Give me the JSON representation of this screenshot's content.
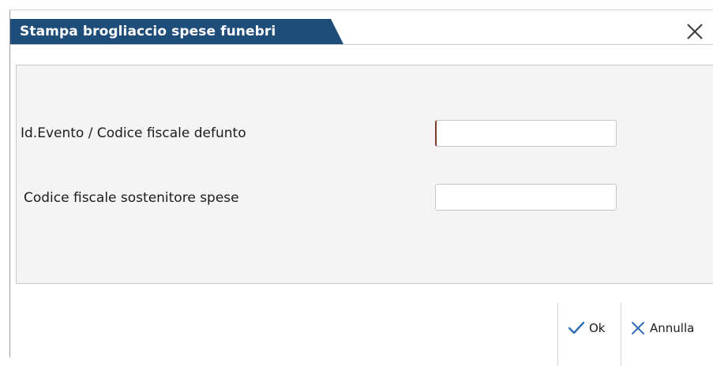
{
  "dialog": {
    "title": "Stampa brogliaccio spese funebri",
    "close_icon": "close-icon"
  },
  "form": {
    "fields": [
      {
        "label": "Id.Evento / Codice fiscale defunto",
        "value": "",
        "placeholder": ""
      },
      {
        "label": "Codice fiscale sostenitore spese",
        "value": "",
        "placeholder": ""
      }
    ]
  },
  "buttons": {
    "ok_label": "Ok",
    "ok_icon": "check-icon",
    "cancel_label": "Annulla",
    "cancel_icon": "close-icon"
  },
  "colors": {
    "title_bar": "#1f4d7a",
    "panel_bg": "#f4f4f4",
    "icon_blue": "#2f6fb3",
    "focus_caret": "#8b3a2b"
  }
}
